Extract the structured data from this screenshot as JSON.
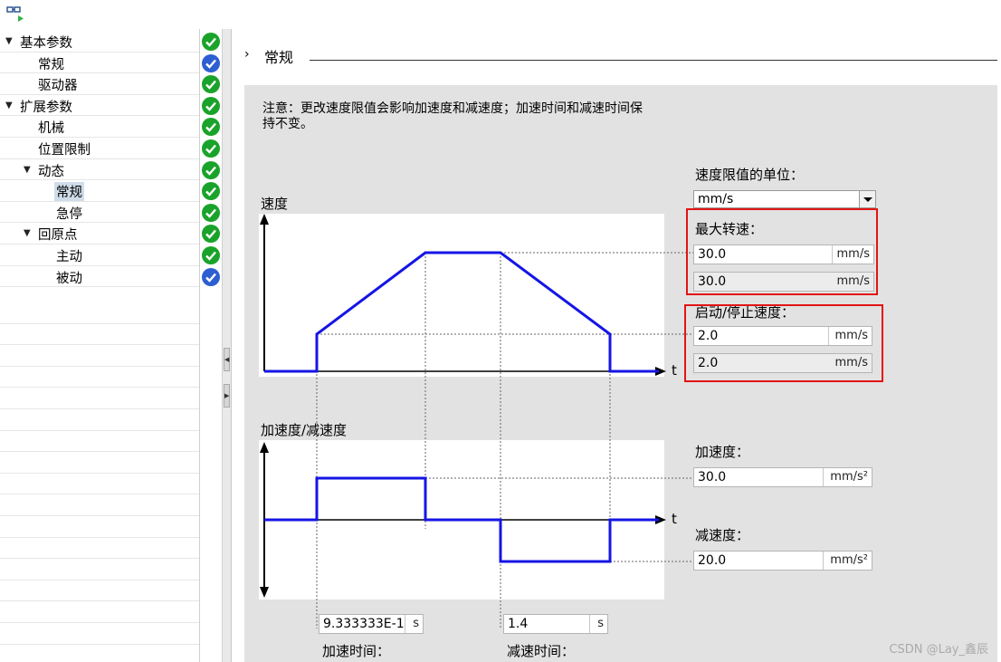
{
  "tree": {
    "items": [
      {
        "label": "基本参数",
        "level": 0,
        "expand": "▼",
        "status": "ok"
      },
      {
        "label": "常规",
        "level": 1,
        "expand": "",
        "status": "blue"
      },
      {
        "label": "驱动器",
        "level": 1,
        "expand": "",
        "status": "ok"
      },
      {
        "label": "扩展参数",
        "level": 0,
        "expand": "▼",
        "status": "ok"
      },
      {
        "label": "机械",
        "level": 1,
        "expand": "",
        "status": "ok"
      },
      {
        "label": "位置限制",
        "level": 1,
        "expand": "",
        "status": "ok"
      },
      {
        "label": "动态",
        "level": 1,
        "expand": "▼",
        "status": "ok"
      },
      {
        "label": "常规",
        "level": 2,
        "expand": "",
        "status": "ok",
        "selected": true
      },
      {
        "label": "急停",
        "level": 2,
        "expand": "",
        "status": "ok"
      },
      {
        "label": "回原点",
        "level": 1,
        "expand": "▼",
        "status": "ok"
      },
      {
        "label": "主动",
        "level": 2,
        "expand": "",
        "status": "ok"
      },
      {
        "label": "被动",
        "level": 2,
        "expand": "",
        "status": "blue"
      }
    ]
  },
  "section": {
    "arrow": "›",
    "title": "常规"
  },
  "note": "注意：更改速度限值会影响加速度和减速度；加速时间和减速时间保持不变。",
  "speed_chart": {
    "ylabel": "速度",
    "xlabel": "t"
  },
  "accel_chart": {
    "ylabel": "加速度/减速度",
    "xlabel": "t"
  },
  "speed_unit": {
    "label": "速度限值的单位：",
    "value": "mm/s"
  },
  "max_speed": {
    "label": "最大转速：",
    "value": "30.0",
    "unit": "mm/s",
    "readonly_value": "30.0",
    "readonly_unit": "mm/s"
  },
  "start_stop_speed": {
    "label": "启动/停止速度：",
    "value": "2.0",
    "unit": "mm/s",
    "readonly_value": "2.0",
    "readonly_unit": "mm/s"
  },
  "acceleration": {
    "label": "加速度：",
    "value": "30.0",
    "unit": "mm/s²"
  },
  "deceleration": {
    "label": "减速度：",
    "value": "20.0",
    "unit": "mm/s²"
  },
  "accel_time": {
    "label": "加速时间：",
    "value": "9.333333E-1",
    "unit": "s"
  },
  "decel_time": {
    "label": "减速时间：",
    "value": "1.4",
    "unit": "s"
  },
  "watermark": "CSDN @Lay_鑫辰",
  "colors": {
    "curve": "#1515e6",
    "ok": "#1aa32a",
    "info": "#2d5fd1",
    "highlight": "#e21414",
    "panel": "#e2e2e2"
  }
}
